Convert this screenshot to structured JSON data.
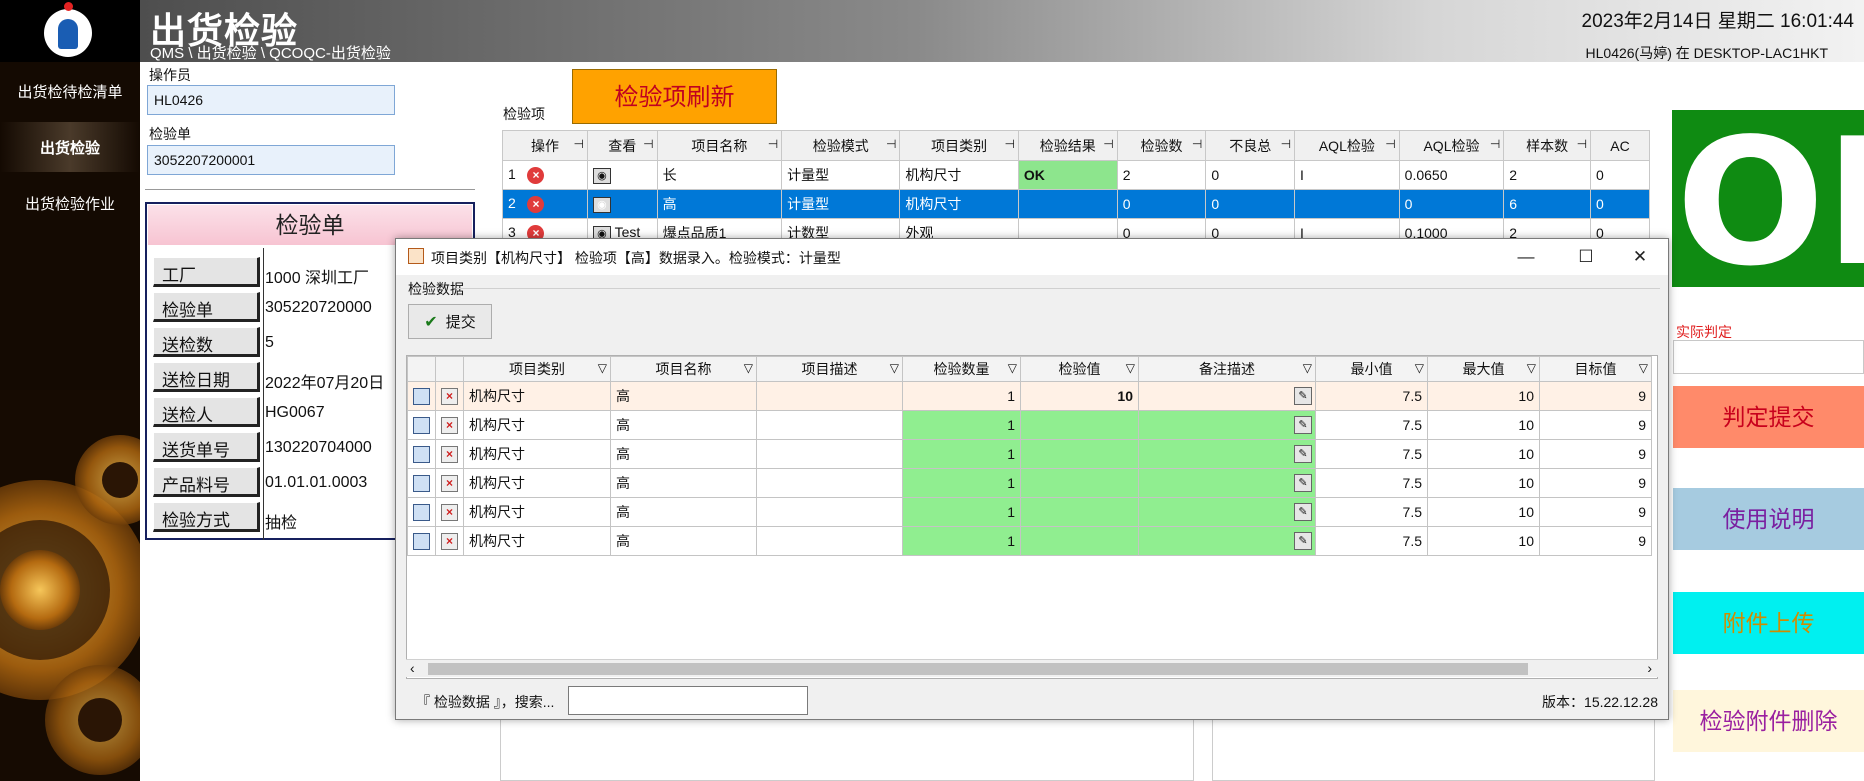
{
  "header": {
    "title": "出货检验",
    "breadcrumb": "QMS \\ 出货检验 \\ QCOQC-出货检验",
    "datetime": "2023年2月14日 星期二 16:01:44",
    "user_host": "HL0426(马婷) 在 DESKTOP-LAC1HKT"
  },
  "sidebar": {
    "items": [
      {
        "label": "出货检待检清单"
      },
      {
        "label": "出货检验"
      },
      {
        "label": "出货检验作业"
      }
    ]
  },
  "form": {
    "operator_label": "操作员",
    "operator_value": "HL0426",
    "order_label": "检验单",
    "order_value": "3052207200001"
  },
  "card": {
    "title": "检验单",
    "rows": [
      {
        "label": "工厂",
        "value": "1000 深圳工厂"
      },
      {
        "label": "检验单",
        "value": "305220720000"
      },
      {
        "label": "送检数",
        "value": "5"
      },
      {
        "label": "送检日期",
        "value": "2022年07月20日"
      },
      {
        "label": "送检人",
        "value": "HG0067"
      },
      {
        "label": "送货单号",
        "value": "130220704000"
      },
      {
        "label": "产品料号",
        "value": "01.01.01.0003"
      },
      {
        "label": "检验方式",
        "value": "抽检"
      }
    ]
  },
  "inspection": {
    "label": "检验项",
    "refresh_button": "检验项刷新",
    "columns": [
      "操作",
      "查看",
      "项目名称",
      "检验模式",
      "项目类别",
      "检验结果",
      "检验数",
      "不良总",
      "AQL检验",
      "AQL检验",
      "样本数",
      "AC"
    ],
    "rows": [
      {
        "no": "1",
        "view": "",
        "name": "长",
        "mode": "计量型",
        "category": "机构尺寸",
        "result": "OK",
        "count": "2",
        "defect": "0",
        "aql1": "I",
        "aql2": "0.0650",
        "sample": "2",
        "ac": "0"
      },
      {
        "no": "2",
        "view": "",
        "name": "高",
        "mode": "计量型",
        "category": "机构尺寸",
        "result": "",
        "count": "0",
        "defect": "0",
        "aql1": "",
        "aql2": "0",
        "sample": "6",
        "ac": "0"
      },
      {
        "no": "3",
        "view": "Test",
        "name": "爆点品质1",
        "mode": "计数型",
        "category": "外观",
        "result": "",
        "count": "0",
        "defect": "0",
        "aql1": "I",
        "aql2": "0.1000",
        "sample": "2",
        "ac": "0"
      }
    ]
  },
  "right_panel": {
    "result": "OK",
    "result_color": "#0f8b12",
    "actual_label": "实际判定",
    "buttons": [
      {
        "label": "判定提交",
        "bg": "#ff8a6a",
        "color": "#c8001c"
      },
      {
        "label": "使用说明",
        "bg": "#a6cbe0",
        "color": "#7a1fa0"
      },
      {
        "label": "附件上传",
        "bg": "#00f0f0",
        "color": "#d08c00"
      },
      {
        "label": "检验附件删除",
        "bg": "#fff6dc",
        "color": "#9a1fa0"
      }
    ]
  },
  "dialog": {
    "title": "项目类别【机构尺寸】 检验项【高】数据录入。检验模式：计量型",
    "group_label": "检验数据",
    "submit": "提交",
    "columns": [
      "项目类别",
      "项目名称",
      "项目描述",
      "检验数量",
      "检验值",
      "备注描述",
      "最小值",
      "最大值",
      "目标值"
    ],
    "rows": [
      {
        "category": "机构尺寸",
        "name": "高",
        "desc": "",
        "qty": "1",
        "value": "10",
        "remark": "",
        "min": "7.5",
        "max": "10",
        "target": "9"
      },
      {
        "category": "机构尺寸",
        "name": "高",
        "desc": "",
        "qty": "1",
        "value": "",
        "remark": "",
        "min": "7.5",
        "max": "10",
        "target": "9"
      },
      {
        "category": "机构尺寸",
        "name": "高",
        "desc": "",
        "qty": "1",
        "value": "",
        "remark": "",
        "min": "7.5",
        "max": "10",
        "target": "9"
      },
      {
        "category": "机构尺寸",
        "name": "高",
        "desc": "",
        "qty": "1",
        "value": "",
        "remark": "",
        "min": "7.5",
        "max": "10",
        "target": "9"
      },
      {
        "category": "机构尺寸",
        "name": "高",
        "desc": "",
        "qty": "1",
        "value": "",
        "remark": "",
        "min": "7.5",
        "max": "10",
        "target": "9"
      },
      {
        "category": "机构尺寸",
        "name": "高",
        "desc": "",
        "qty": "1",
        "value": "",
        "remark": "",
        "min": "7.5",
        "max": "10",
        "target": "9"
      }
    ],
    "status": "『 检验数据 』，搜索...",
    "version": "版本：15.22.12.28"
  }
}
